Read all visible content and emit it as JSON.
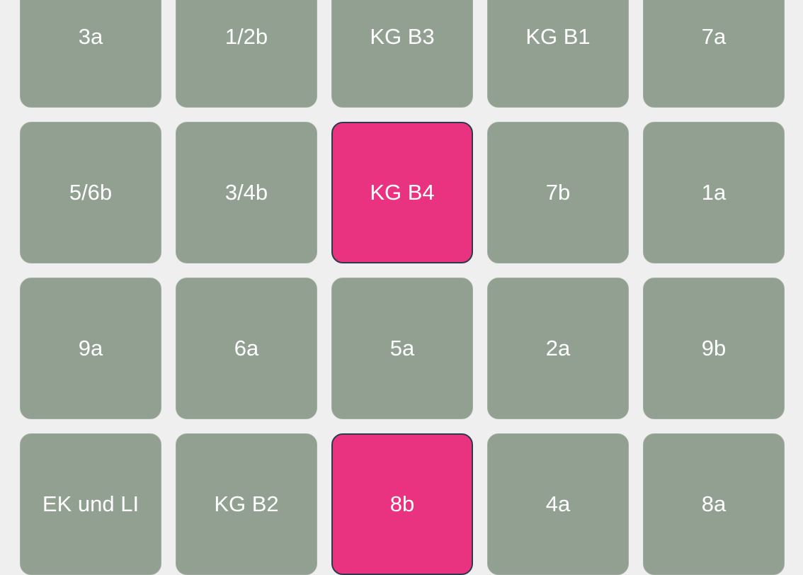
{
  "tiles": [
    {
      "label": "3a",
      "selected": false
    },
    {
      "label": "1/2b",
      "selected": false
    },
    {
      "label": "KG B3",
      "selected": false
    },
    {
      "label": "KG B1",
      "selected": false
    },
    {
      "label": "7a",
      "selected": false
    },
    {
      "label": "5/6b",
      "selected": false
    },
    {
      "label": "3/4b",
      "selected": false
    },
    {
      "label": "KG B4",
      "selected": true
    },
    {
      "label": "7b",
      "selected": false
    },
    {
      "label": "1a",
      "selected": false
    },
    {
      "label": "9a",
      "selected": false
    },
    {
      "label": "6a",
      "selected": false
    },
    {
      "label": "5a",
      "selected": false
    },
    {
      "label": "2a",
      "selected": false
    },
    {
      "label": "9b",
      "selected": false
    },
    {
      "label": "EK und LI",
      "selected": false
    },
    {
      "label": "KG B2",
      "selected": false
    },
    {
      "label": "8b",
      "selected": true
    },
    {
      "label": "4a",
      "selected": false
    },
    {
      "label": "8a",
      "selected": false
    }
  ],
  "colors": {
    "tile_default": "#91a090",
    "tile_selected": "#e93380",
    "background": "#efefef",
    "text": "#ffffff"
  }
}
